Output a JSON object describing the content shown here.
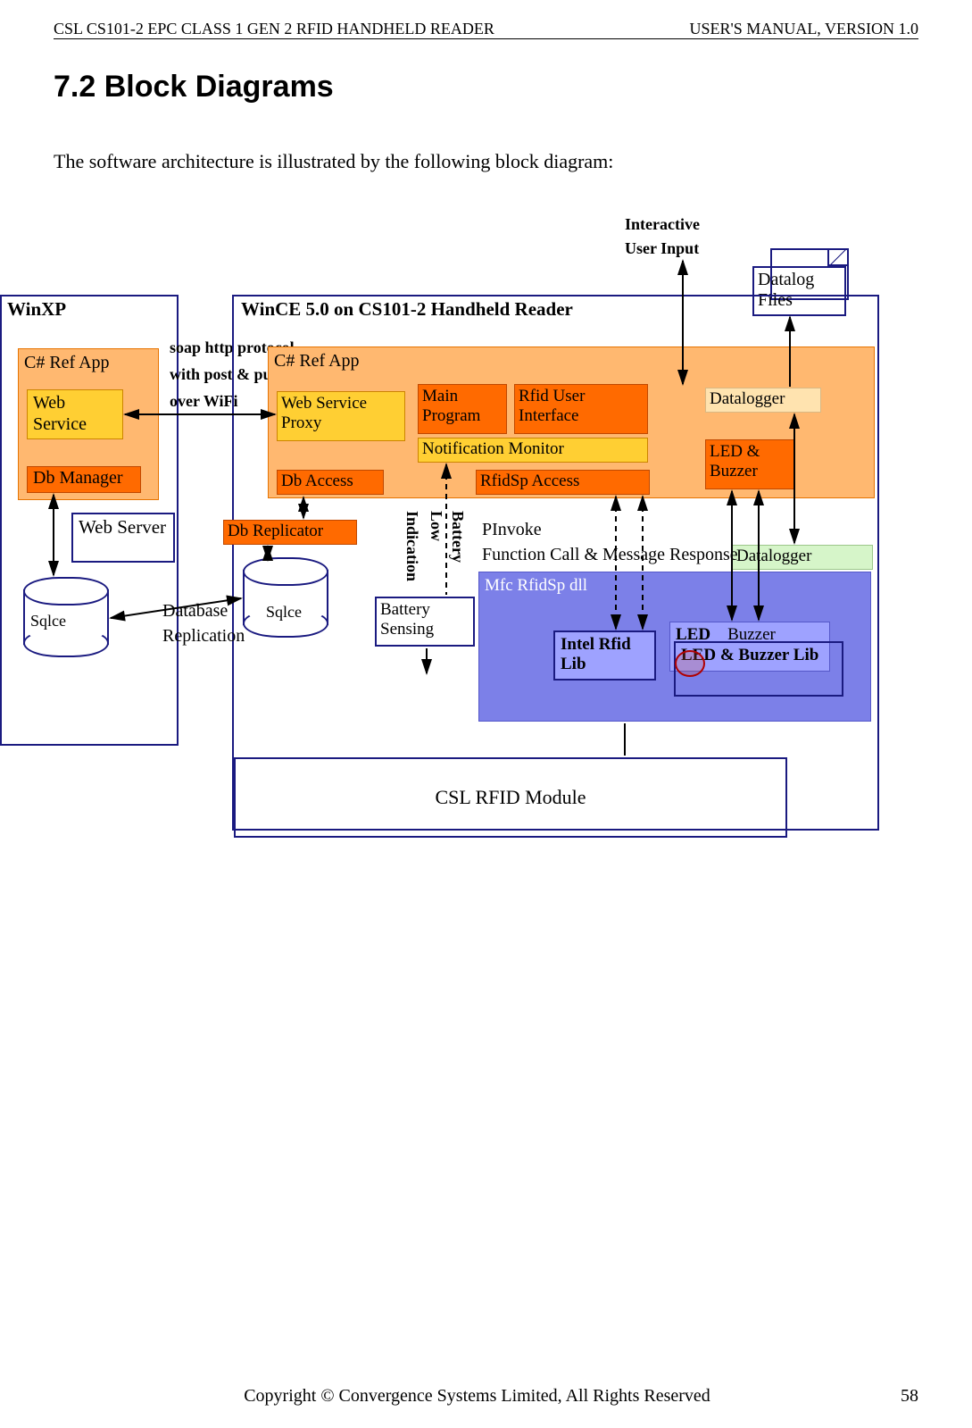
{
  "header": {
    "left": "CSL CS101-2 EPC CLASS 1 GEN 2 RFID HANDHELD READER",
    "right": "USER'S  MANUAL,  VERSION  1.0"
  },
  "section_title": "7.2    Block Diagrams",
  "intro": "The software architecture is illustrated by the following block diagram:",
  "footer": {
    "copyright": "Copyright © Convergence Systems Limited, All Rights Reserved",
    "page": "58"
  },
  "diagram": {
    "interactive_user_input": {
      "line1": "Interactive",
      "line2": "User Input"
    },
    "win_xp": {
      "title": "WinXP",
      "csharp": "C# Ref App",
      "web_service": "Web Service",
      "db_manager": "Db Manager",
      "web_server": "Web Server",
      "sqlce": "Sqlce"
    },
    "soap_protocol": {
      "l1": "soap http protocol",
      "l2": "with post & push",
      "l3": "over WiFi"
    },
    "win_ce": {
      "title": "WinCE 5.0 on CS101-2 Handheld Reader",
      "csharp": "C# Ref App",
      "web_proxy": "Web  Service Proxy",
      "db_access": "Db Access",
      "main_program": "Main Program",
      "rfid_ui": "Rfid User Interface",
      "notification": "Notification Monitor",
      "rfidsp_access": "RfidSp Access",
      "datalogger": "Datalogger",
      "led_buzzer": "LED & Buzzer",
      "db_replicator": "Db Replicator",
      "sqlce": "Sqlce",
      "battery_sensing": "Battery Sensing",
      "datalogger2": "Datalogger",
      "mfc": "Mfc RfidSp dll",
      "intel_rfid": "Intel Rfid Lib",
      "led_buzzer_back": {
        "left": "LED",
        "right": "Buzzer"
      },
      "led_buzzer_lib": "LED        & Buzzer Lib"
    },
    "datalog_files": "Datalog Files",
    "db_replication": {
      "l1": "Database",
      "l2": "Replication"
    },
    "battery_low": {
      "l1": "Battery",
      "l2": "Low",
      "l3": "Indication"
    },
    "pinvoke": "PInvoke",
    "function_call": "Function Call & Message Response",
    "csl_module": "CSL RFID Module"
  }
}
